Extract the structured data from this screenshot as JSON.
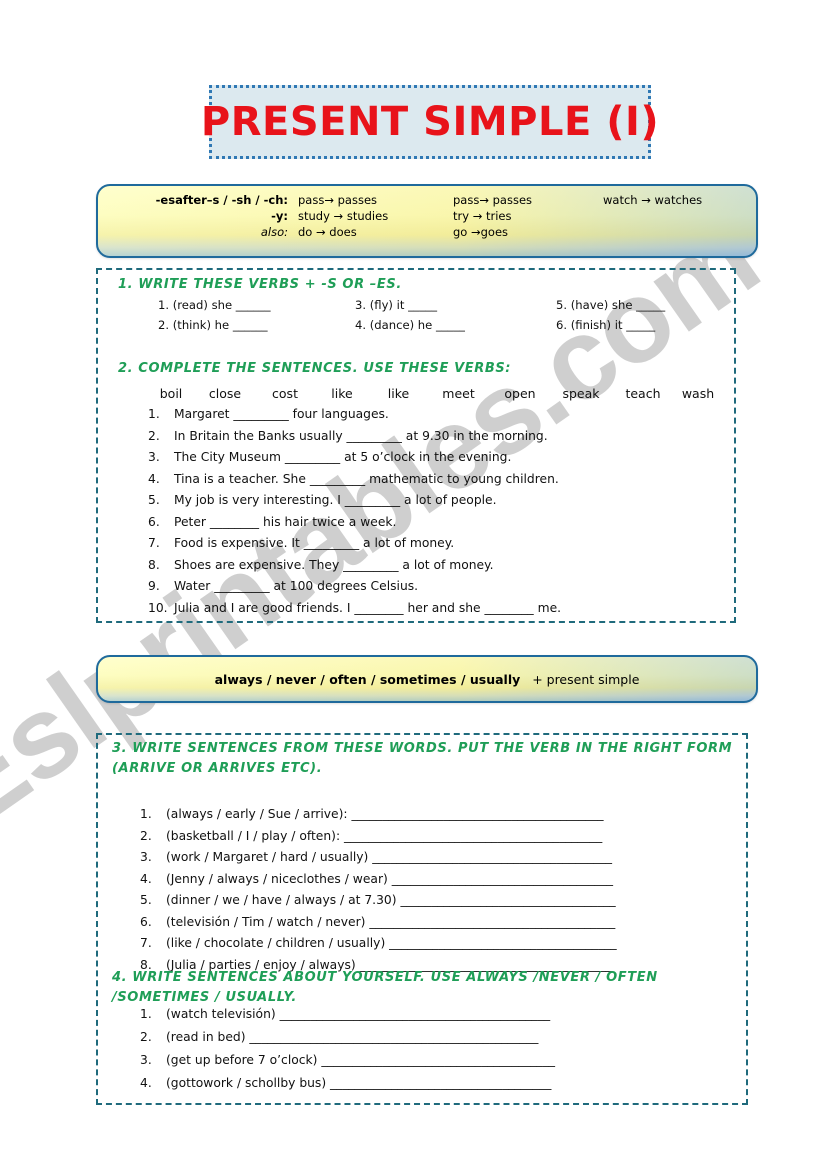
{
  "worksheet": {
    "title": "PRESENT SIMPLE (I)",
    "watermark": "Eslprintables.com",
    "colors": {
      "title_text": "#e8131a",
      "title_bg": "#dce9ef",
      "title_border": "#2f78b4",
      "heading_green": "#1f9e57",
      "panel_border": "#1f6a7c",
      "box_border": "#1f6a9c"
    }
  },
  "rules_box": {
    "rows": [
      {
        "label": "-esafter–s / -sh / -ch:",
        "label_style": "bold",
        "col1": "pass→ passes",
        "col2": "pass→ passes",
        "col3": "watch → watches"
      },
      {
        "label": "-y:",
        "label_style": "bold",
        "col1": "study → studies",
        "col2": "try → tries",
        "col3": ""
      },
      {
        "label": "also:",
        "label_style": "italic",
        "col1": "do → does",
        "col2": "go →goes",
        "col3": ""
      }
    ]
  },
  "exercise1": {
    "heading": "1.   WRITE THESE VERBS + -S OR –ES.",
    "items": [
      {
        "num": "1.",
        "text": "(read)  she ______"
      },
      {
        "num": "2.",
        "text": "(think) he ______"
      },
      {
        "num": "3.",
        "text": "(fly) it _____"
      },
      {
        "num": "4.",
        "text": "(dance) he _____"
      },
      {
        "num": "5.",
        "text": "(have) she _____"
      },
      {
        "num": "6.",
        "text": "(finish) it _____"
      }
    ]
  },
  "exercise2": {
    "heading": "2.   COMPLETE THE SENTENCES. USE  THESE VERBS:",
    "wordbank": [
      "boil",
      "close",
      "cost",
      "like",
      "like",
      "meet",
      "open",
      "speak",
      "teach",
      "wash"
    ],
    "items": [
      {
        "num": "1.",
        "text": "Margaret _________ four languages."
      },
      {
        "num": "2.",
        "text": "In Britain the Banks usually _________ at 9.30 in the morning."
      },
      {
        "num": "3.",
        "text": "The City Museum _________ at  5 o’clock in the evening."
      },
      {
        "num": "4.",
        "text": "Tina is a teacher. She _________ mathematic to young children."
      },
      {
        "num": "5.",
        "text": "My job is very interesting. I _________ a lot of people."
      },
      {
        "num": "6.",
        "text": "Peter ________ his hair twice a week."
      },
      {
        "num": "7.",
        "text": "Food is expensive. It _________ a lot of money."
      },
      {
        "num": "8.",
        "text": "Shoes are expensive. They _________ a lot of money."
      },
      {
        "num": "9.",
        "text": "Water _________ at 100 degrees Celsius."
      },
      {
        "num": "10.",
        "text": "Julia and I are good friends. I ________ her and she ________ me."
      }
    ]
  },
  "adverbs_box": {
    "adverbs": "always / never / often / sometimes / usually",
    "suffix": "+ present simple"
  },
  "exercise3": {
    "heading": "3. WRITE  SENTENCES  FROM  THESE  WORDS.  PUT  THE  VERB  IN  THE  RIGHT  FORM (ARRIVE OR ARRIVES ETC).",
    "items": [
      {
        "num": "1.",
        "text": "(always / early / Sue / arrive): _________________________________________"
      },
      {
        "num": "2.",
        "text": "(basketball / I / play / often): __________________________________________"
      },
      {
        "num": "3.",
        "text": "(work / Margaret / hard / usually) _______________________________________"
      },
      {
        "num": "4.",
        "text": "(Jenny / always / niceclothes / wear) ____________________________________"
      },
      {
        "num": "5.",
        "text": "(dinner / we / have / always / at 7.30) ___________________________________"
      },
      {
        "num": "6.",
        "text": "(televisión / Tim / watch / never) ________________________________________"
      },
      {
        "num": "7.",
        "text": "(like / chocolate / children / usually) _____________________________________"
      },
      {
        "num": "8.",
        "text": "(Julia / parties / enjoy / always) _________________________________________"
      }
    ]
  },
  "exercise4": {
    "heading": "4.  WRITE  SENTENCES  ABOUT  YOURSELF.  USE  ALWAYS  /NEVER  /  OFTEN /SOMETIMES / USUALLY.",
    "items": [
      {
        "num": "1.",
        "text": "(watch televisión) ____________________________________________"
      },
      {
        "num": "2.",
        "text": "(read in bed) _______________________________________________"
      },
      {
        "num": "3.",
        "text": "(get up before 7 o’clock) ______________________________________"
      },
      {
        "num": "4.",
        "text": "(gottowork / schollby bus) ____________________________________"
      }
    ]
  }
}
